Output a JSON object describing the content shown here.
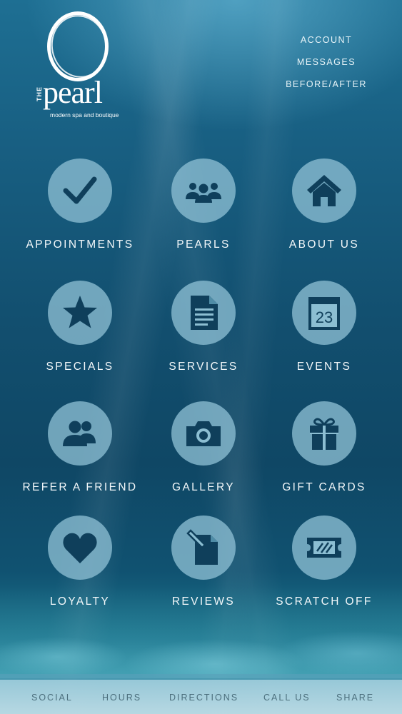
{
  "logo": {
    "the": "THE",
    "word": "pearl",
    "tagline": "modern spa and boutique"
  },
  "top_links": [
    "ACCOUNT",
    "MESSAGES",
    "BEFORE/AFTER"
  ],
  "tiles": [
    {
      "label": "APPOINTMENTS",
      "icon": "checkmark-icon"
    },
    {
      "label": "PEARLS",
      "icon": "group-icon"
    },
    {
      "label": "ABOUT US",
      "icon": "home-icon"
    },
    {
      "label": "SPECIALS",
      "icon": "star-icon"
    },
    {
      "label": "SERVICES",
      "icon": "document-icon"
    },
    {
      "label": "EVENTS",
      "icon": "calendar-icon",
      "calendar_day": "23"
    },
    {
      "label": "REFER A FRIEND",
      "icon": "people-icon"
    },
    {
      "label": "GALLERY",
      "icon": "camera-icon"
    },
    {
      "label": "GIFT CARDS",
      "icon": "gift-icon"
    },
    {
      "label": "LOYALTY",
      "icon": "heart-icon"
    },
    {
      "label": "REVIEWS",
      "icon": "pencil-document-icon"
    },
    {
      "label": "SCRATCH OFF",
      "icon": "ticket-icon"
    }
  ],
  "bottom_bar": [
    "SOCIAL",
    "HOURS",
    "DIRECTIONS",
    "CALL US",
    "SHARE"
  ],
  "colors": {
    "icon_fill": "#0f3f5b",
    "circle": "#8cbed2",
    "label": "#f3f8fa",
    "bottom_text": "#4c6f7d"
  }
}
